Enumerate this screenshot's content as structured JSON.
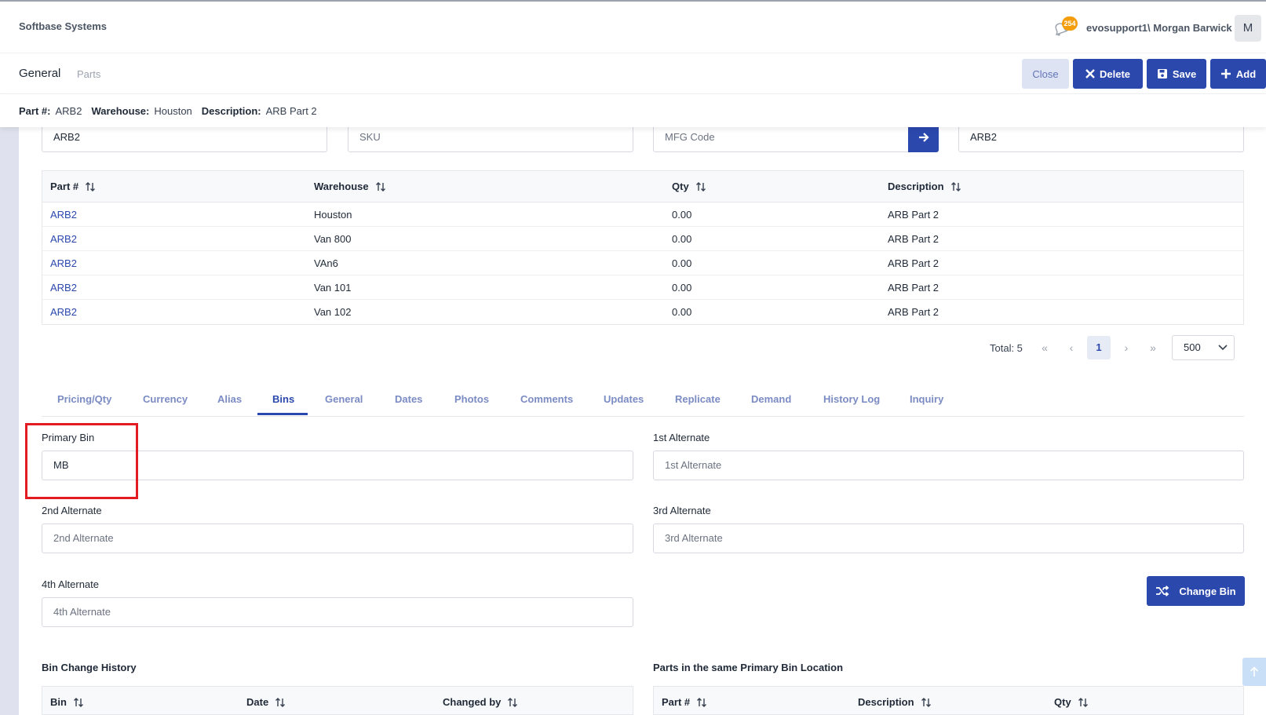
{
  "app": {
    "brand": "Softbase Systems",
    "notifications_count": "254",
    "user": "evosupport1\\ Morgan Barwick",
    "avatar_initial": "M"
  },
  "titlebar": {
    "section": "General",
    "subsection": "Parts",
    "buttons": {
      "close": "Close",
      "delete": "Delete",
      "save": "Save",
      "add": "Add"
    }
  },
  "info": {
    "part_label": "Part #:",
    "part_value": "ARB2",
    "warehouse_label": "Warehouse:",
    "warehouse_value": "Houston",
    "description_label": "Description:",
    "description_value": "ARB Part 2"
  },
  "search": {
    "part_value": "ARB2",
    "sku_placeholder": "SKU",
    "mfg_placeholder": "MFG Code",
    "desc_value": "ARB2"
  },
  "table": {
    "headers": [
      "Part #",
      "Warehouse",
      "Qty",
      "Description"
    ],
    "rows": [
      [
        "ARB2",
        "Houston",
        "0.00",
        "ARB Part 2"
      ],
      [
        "ARB2",
        "Van 800",
        "0.00",
        "ARB Part 2"
      ],
      [
        "ARB2",
        "VAn6",
        "0.00",
        "ARB Part 2"
      ],
      [
        "ARB2",
        "Van 101",
        "0.00",
        "ARB Part 2"
      ],
      [
        "ARB2",
        "Van 102",
        "0.00",
        "ARB Part 2"
      ]
    ]
  },
  "pagination": {
    "total": "Total: 5",
    "current_page": "1",
    "page_size": "500"
  },
  "tabs": [
    "Pricing/Qty",
    "Currency",
    "Alias",
    "Bins",
    "General",
    "Dates",
    "Photos",
    "Comments",
    "Updates",
    "Replicate",
    "Demand",
    "History Log",
    "Inquiry"
  ],
  "active_tab": "Bins",
  "bins": {
    "primary_label": "Primary Bin",
    "primary_value": "MB",
    "alt1_label": "1st Alternate",
    "alt1_placeholder": "1st Alternate",
    "alt2_label": "2nd Alternate",
    "alt2_placeholder": "2nd Alternate",
    "alt3_label": "3rd Alternate",
    "alt3_placeholder": "3rd Alternate",
    "alt4_label": "4th Alternate",
    "alt4_placeholder": "4th Alternate",
    "change_bin": "Change Bin"
  },
  "history": {
    "title": "Bin Change History",
    "headers": [
      "Bin",
      "Date",
      "Changed by"
    ]
  },
  "same_bin": {
    "title": "Parts in the same Primary Bin Location",
    "headers": [
      "Part #",
      "Description",
      "Qty"
    ]
  },
  "colors": {
    "primary": "#2b48ad",
    "highlight": "#e31b23",
    "badge": "#f59e0b"
  }
}
